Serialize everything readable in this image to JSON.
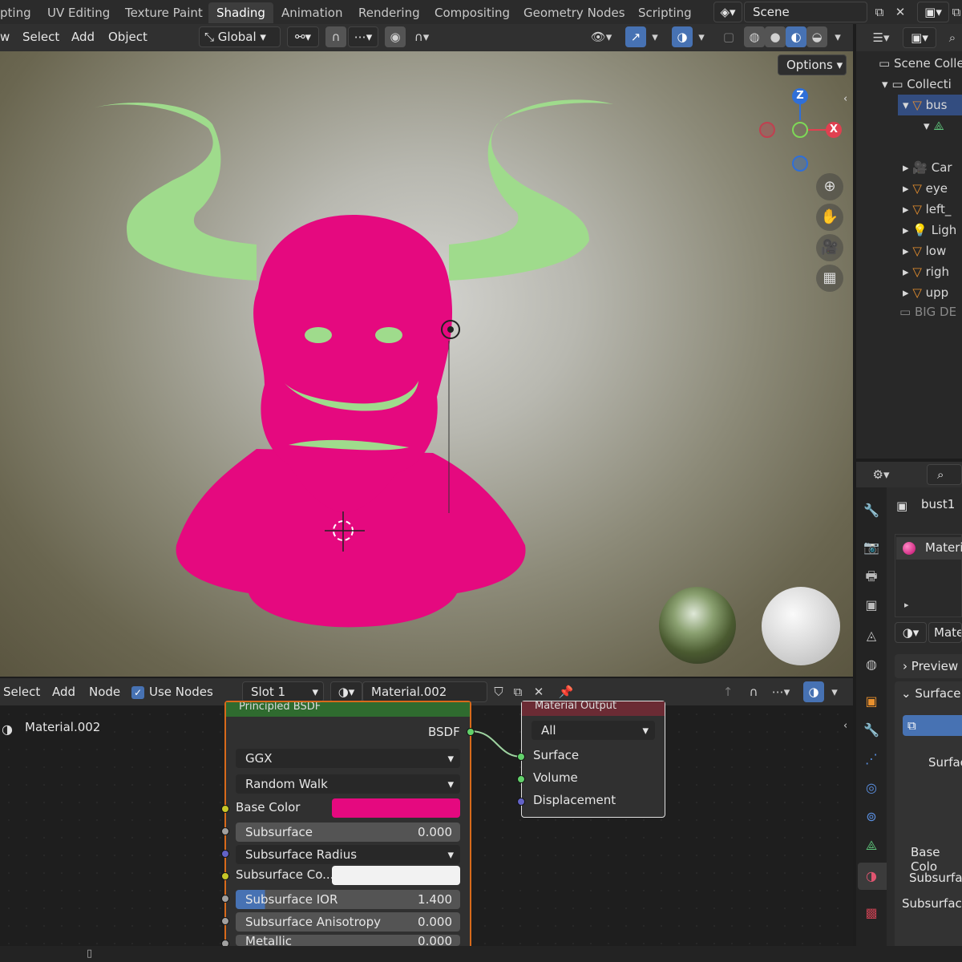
{
  "workspace_tabs": [
    {
      "label": "pting"
    },
    {
      "label": "UV Editing"
    },
    {
      "label": "Texture Paint"
    },
    {
      "label": "Shading"
    },
    {
      "label": "Animation"
    },
    {
      "label": "Rendering"
    },
    {
      "label": "Compositing"
    },
    {
      "label": "Geometry Nodes"
    },
    {
      "label": "Scripting"
    }
  ],
  "scene_name": "Scene",
  "viewport_header": {
    "menus": [
      "w",
      "Select",
      "Add",
      "Object"
    ],
    "transform_orientation": "Global",
    "options_label": "Options"
  },
  "gizmo": {
    "z": "Z",
    "x": "X"
  },
  "outliner": {
    "rows": [
      {
        "label": "Scene Colle"
      },
      {
        "label": "Collecti"
      },
      {
        "label": "bus"
      },
      {
        "label": "Car"
      },
      {
        "label": "eye"
      },
      {
        "label": "left_"
      },
      {
        "label": "Ligh"
      },
      {
        "label": "low"
      },
      {
        "label": "righ"
      },
      {
        "label": "upp"
      },
      {
        "label": "BIG DE"
      }
    ]
  },
  "node_header": {
    "menus": [
      "Select",
      "Add",
      "Node"
    ],
    "use_nodes_label": "Use Nodes",
    "slot": "Slot 1",
    "material": "Material.002"
  },
  "node_editor": {
    "breadcrumb": "Material.002",
    "bsdf_node": {
      "title": "Principled BSDF",
      "output": "BSDF",
      "distribution": "GGX",
      "subsurface_method": "Random Walk",
      "base_color_label": "Base Color",
      "base_color": "#e5097f",
      "subsurface_label": "Subsurface",
      "subsurface_value": "0.000",
      "subsurface_radius_label": "Subsurface Radius",
      "subsurface_color_label": "Subsurface Co...",
      "subsurface_ior_label": "Subsurface IOR",
      "subsurface_ior_value": "1.400",
      "subsurface_anisotropy_label": "Subsurface Anisotropy",
      "subsurface_anisotropy_value": "0.000",
      "metallic_label": "Metallic",
      "metallic_value": "0.000"
    },
    "output_node": {
      "title": "Material Output",
      "target": "All",
      "inputs": [
        "Surface",
        "Volume",
        "Displacement"
      ]
    }
  },
  "properties": {
    "object_name": "bust1",
    "material_slot": "Materi",
    "material_browse": "Mate",
    "preview_label": "Preview",
    "surface_label": "Surface",
    "surface_field": "Surfac",
    "base_color_label": "Base Colo",
    "subsurface1": "Subsurfac",
    "subsurface2": "Subsurface"
  },
  "colors": {
    "accent_blue": "#4772b3",
    "bust_pink": "#e5097f",
    "horn_green": "#9fdb8c",
    "node_header_green": "#2f6b2f",
    "output_header_red": "#6b2b34"
  }
}
